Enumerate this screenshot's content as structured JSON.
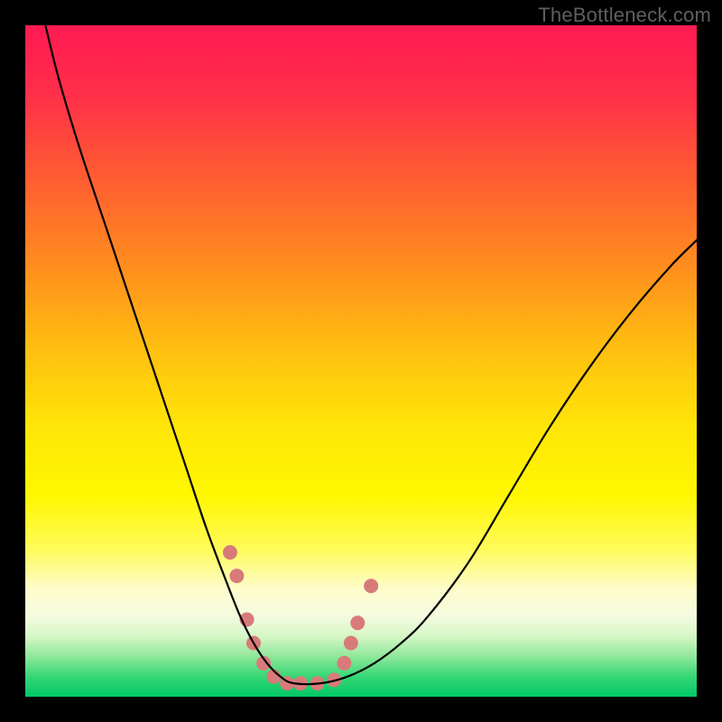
{
  "watermark": "TheBottleneck.com",
  "chart_data": {
    "type": "line",
    "title": "",
    "xlabel": "",
    "ylabel": "",
    "xlim": [
      0,
      100
    ],
    "ylim": [
      0,
      100
    ],
    "grid": false,
    "legend": false,
    "background_gradient_stops": [
      {
        "offset": 0.0,
        "color": "#ff1a52"
      },
      {
        "offset": 0.1,
        "color": "#ff2e4a"
      },
      {
        "offset": 0.22,
        "color": "#ff5a33"
      },
      {
        "offset": 0.35,
        "color": "#ff8a1f"
      },
      {
        "offset": 0.48,
        "color": "#ffbe10"
      },
      {
        "offset": 0.6,
        "color": "#ffe608"
      },
      {
        "offset": 0.7,
        "color": "#fff700"
      },
      {
        "offset": 0.78,
        "color": "#fffb5a"
      },
      {
        "offset": 0.84,
        "color": "#fdfccb"
      },
      {
        "offset": 0.88,
        "color": "#f4fbe0"
      },
      {
        "offset": 0.91,
        "color": "#d6f6c6"
      },
      {
        "offset": 0.94,
        "color": "#8fe89a"
      },
      {
        "offset": 0.97,
        "color": "#36d775"
      },
      {
        "offset": 1.0,
        "color": "#00c866"
      }
    ],
    "series": [
      {
        "name": "bottleneck-curve",
        "stroke": "#000000",
        "x": [
          3,
          5,
          8,
          12,
          16,
          20,
          24,
          27,
          30,
          32,
          34,
          36,
          38,
          40,
          44,
          48,
          52,
          56,
          60,
          66,
          72,
          78,
          84,
          90,
          96,
          100
        ],
        "y": [
          100,
          92,
          82,
          70,
          58,
          46,
          34,
          25,
          17,
          12,
          8,
          5,
          3,
          2,
          2,
          3,
          5,
          8,
          12,
          20,
          30,
          40,
          49,
          57,
          64,
          68
        ]
      }
    ],
    "markers": {
      "name": "highlight-dots",
      "color": "#d97a7a",
      "radius": 8,
      "points": [
        {
          "x": 30.5,
          "y": 21.5
        },
        {
          "x": 31.5,
          "y": 18.0
        },
        {
          "x": 33.0,
          "y": 11.5
        },
        {
          "x": 34.0,
          "y": 8.0
        },
        {
          "x": 35.5,
          "y": 5.0
        },
        {
          "x": 37.0,
          "y": 3.0
        },
        {
          "x": 39.0,
          "y": 2.0
        },
        {
          "x": 41.0,
          "y": 2.0
        },
        {
          "x": 43.5,
          "y": 2.0
        },
        {
          "x": 46.0,
          "y": 2.5
        },
        {
          "x": 47.5,
          "y": 5.0
        },
        {
          "x": 48.5,
          "y": 8.0
        },
        {
          "x": 49.5,
          "y": 11.0
        },
        {
          "x": 51.5,
          "y": 16.5
        }
      ]
    }
  }
}
